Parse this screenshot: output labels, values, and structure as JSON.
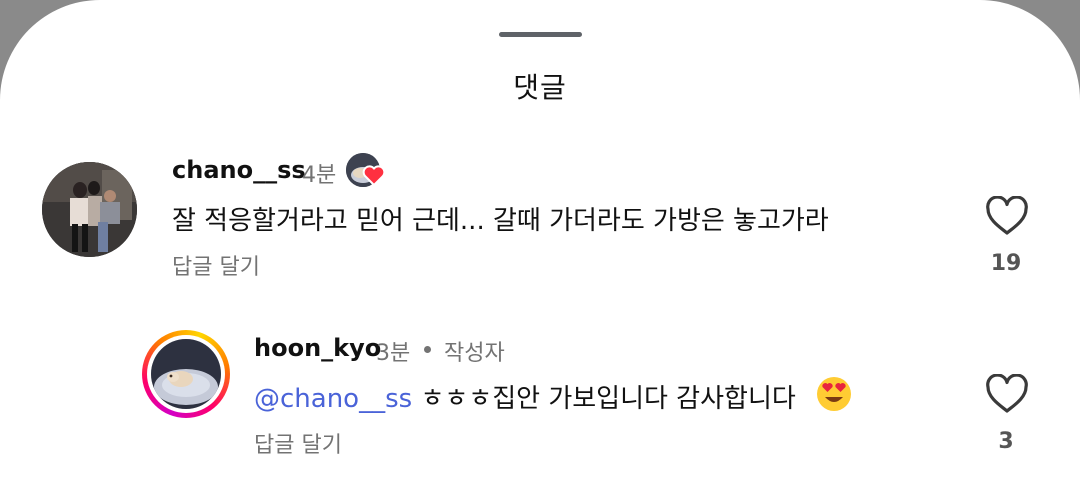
{
  "sheet": {
    "title": "댓글"
  },
  "comments": [
    {
      "username": "chano__ss",
      "time": "4분",
      "text": "잘 적응할거라고 믿어 근데... 갈때 가더라도 가방은 놓고가라",
      "reply_label": "답글 달기",
      "likes": "19"
    },
    {
      "username": "hoon_kyo",
      "time": "3분",
      "author_badge": "작성자",
      "mention": "@chano__ss",
      "text": "ㅎㅎㅎ집안 가보입니다 감사합니다",
      "reply_label": "답글 달기",
      "likes": "3"
    }
  ],
  "icons": {
    "like": "heart-outline-icon",
    "creator_like": "heart-filled-icon",
    "emoji": "heart-eyes-emoji"
  },
  "colors": {
    "mention": "#4a63d8",
    "heart_red": "#ff3040",
    "muted_text": "#737373"
  }
}
